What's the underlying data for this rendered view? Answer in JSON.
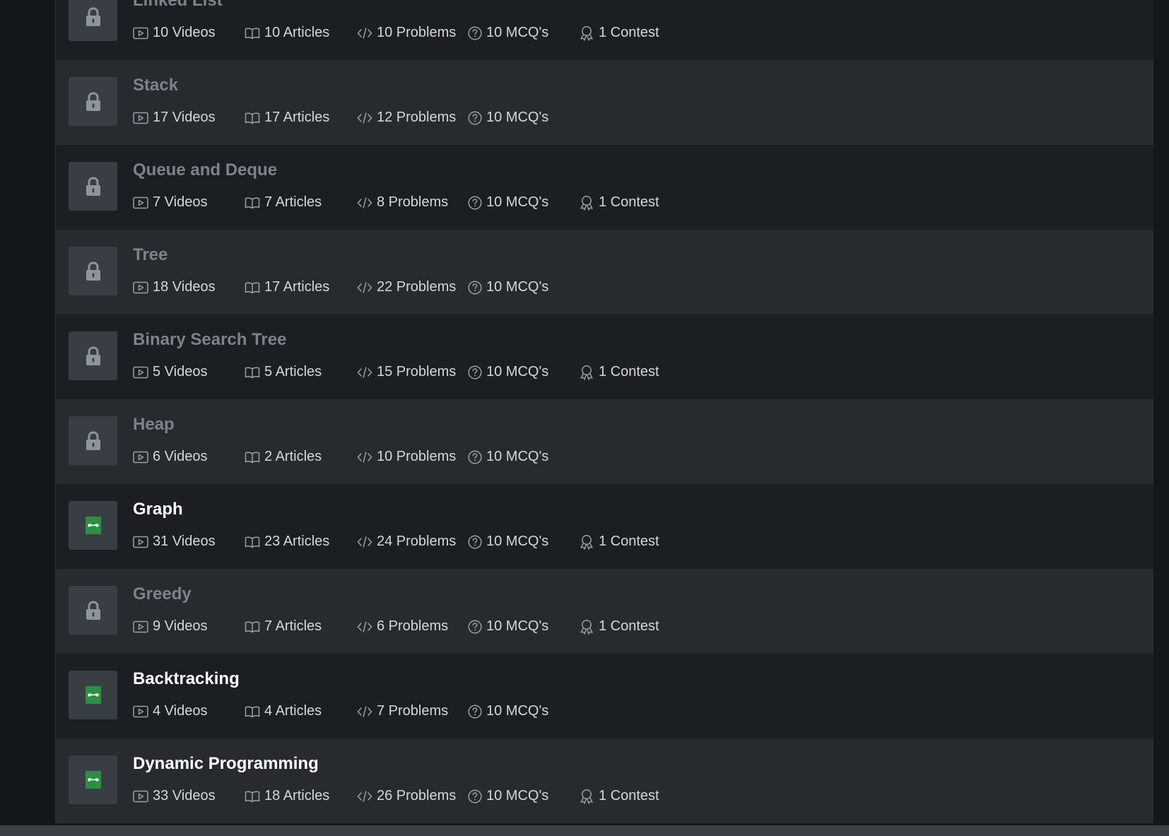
{
  "colors": {
    "row_dark": "#1b1e22",
    "row_light": "#272b30",
    "locked_title": "#7d838b",
    "unlocked_title": "#ffffff",
    "stat_text": "#d4d7db",
    "brand_green": "#2f8d46"
  },
  "icons": {
    "locked": "lock-icon",
    "unlocked": "gfg-logo-icon",
    "videos": "video-play-icon",
    "articles": "open-book-icon",
    "problems": "code-icon",
    "mcqs": "question-circle-icon",
    "contest": "award-ribbon-icon"
  },
  "topics": [
    {
      "title": "Linked List",
      "locked": true,
      "videos": "10 Videos",
      "articles": "10 Articles",
      "problems": "10 Problems",
      "mcqs": "10 MCQ's",
      "contest": "1 Contest"
    },
    {
      "title": "Stack",
      "locked": true,
      "videos": "17 Videos",
      "articles": "17 Articles",
      "problems": "12 Problems",
      "mcqs": "10 MCQ's",
      "contest": ""
    },
    {
      "title": "Queue and Deque",
      "locked": true,
      "videos": "7 Videos",
      "articles": "7 Articles",
      "problems": "8 Problems",
      "mcqs": "10 MCQ's",
      "contest": "1 Contest"
    },
    {
      "title": "Tree",
      "locked": true,
      "videos": "18 Videos",
      "articles": "17 Articles",
      "problems": "22 Problems",
      "mcqs": "10 MCQ's",
      "contest": ""
    },
    {
      "title": "Binary Search Tree",
      "locked": true,
      "videos": "5 Videos",
      "articles": "5 Articles",
      "problems": "15 Problems",
      "mcqs": "10 MCQ's",
      "contest": "1 Contest"
    },
    {
      "title": "Heap",
      "locked": true,
      "videos": "6 Videos",
      "articles": "2 Articles",
      "problems": "10 Problems",
      "mcqs": "10 MCQ's",
      "contest": ""
    },
    {
      "title": "Graph",
      "locked": false,
      "videos": "31 Videos",
      "articles": "23 Articles",
      "problems": "24 Problems",
      "mcqs": "10 MCQ's",
      "contest": "1 Contest"
    },
    {
      "title": "Greedy",
      "locked": true,
      "videos": "9 Videos",
      "articles": "7 Articles",
      "problems": "6 Problems",
      "mcqs": "10 MCQ's",
      "contest": "1 Contest"
    },
    {
      "title": "Backtracking",
      "locked": false,
      "videos": "4 Videos",
      "articles": "4 Articles",
      "problems": "7 Problems",
      "mcqs": "10 MCQ's",
      "contest": ""
    },
    {
      "title": "Dynamic Programming",
      "locked": false,
      "videos": "33 Videos",
      "articles": "18 Articles",
      "problems": "26 Problems",
      "mcqs": "10 MCQ's",
      "contest": "1 Contest"
    }
  ]
}
